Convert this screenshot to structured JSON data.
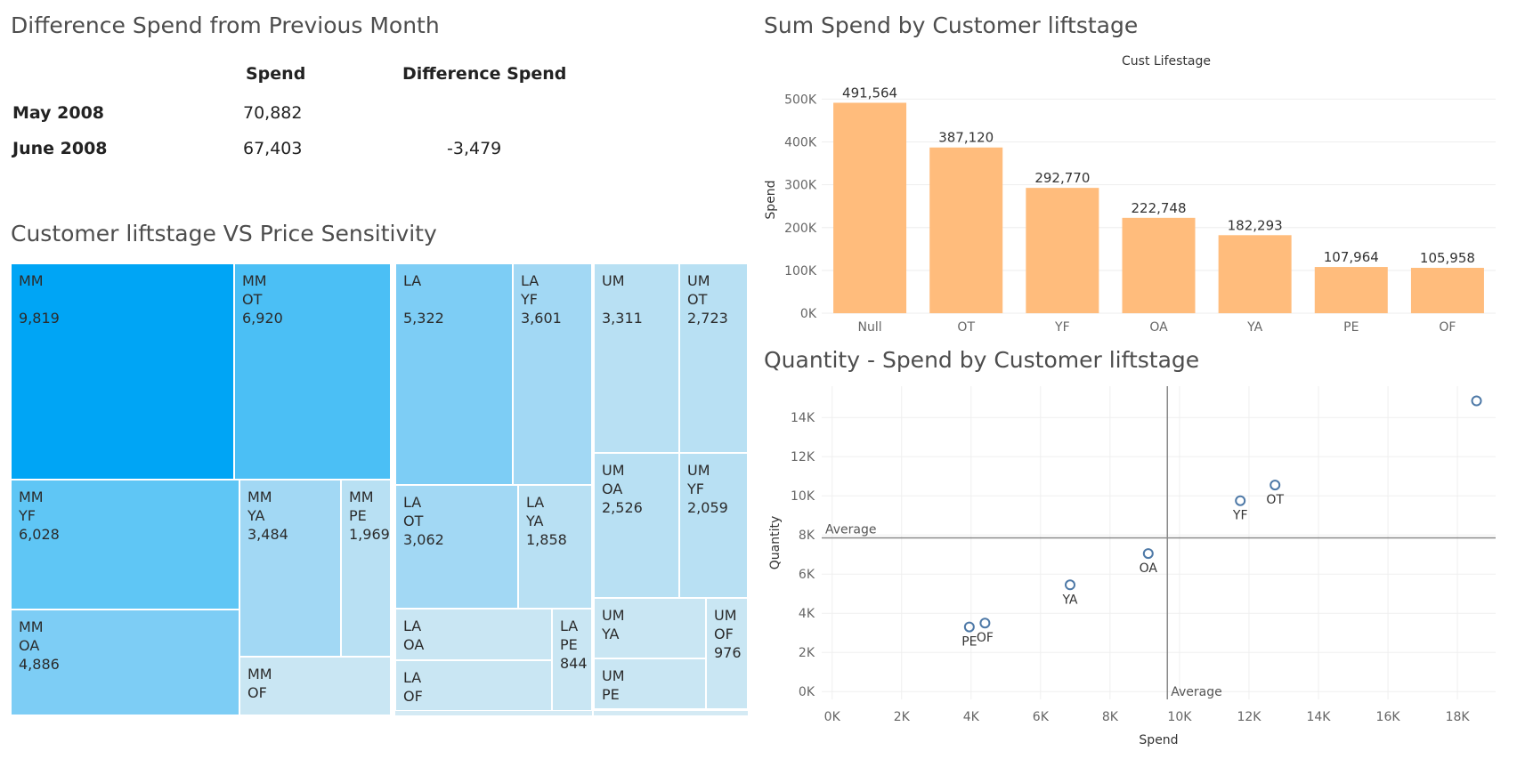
{
  "diff_table": {
    "title": "Difference Spend from Previous Month",
    "headers": [
      "Spend",
      "Difference Spend"
    ],
    "rows": [
      {
        "label": "May 2008",
        "spend": "70,882",
        "diff": ""
      },
      {
        "label": "June 2008",
        "spend": "67,403",
        "diff": "-3,479"
      }
    ]
  },
  "treemap": {
    "title": "Customer liftstage VS Price Sensitivity",
    "colors": {
      "dark": "#00a5f5",
      "mid1": "#4bbff5",
      "mid2": "#5fc6f5",
      "mid3": "#7dcdf5",
      "light1": "#a2d8f4",
      "light2": "#b8e0f3",
      "light3": "#c9e6f3",
      "light4": "#d4eaf4"
    },
    "tiles": [
      {
        "group": "MM",
        "life": "",
        "value": "9,819"
      },
      {
        "group": "MM",
        "life": "OT",
        "value": "6,920"
      },
      {
        "group": "MM",
        "life": "YF",
        "value": "6,028"
      },
      {
        "group": "MM",
        "life": "YA",
        "value": "3,484"
      },
      {
        "group": "MM",
        "life": "PE",
        "value": "1,969"
      },
      {
        "group": "MM",
        "life": "OA",
        "value": "4,886"
      },
      {
        "group": "MM",
        "life": "OF",
        "value": ""
      },
      {
        "group": "LA",
        "life": "",
        "value": "5,322"
      },
      {
        "group": "LA",
        "life": "YF",
        "value": "3,601"
      },
      {
        "group": "LA",
        "life": "OT",
        "value": "3,062"
      },
      {
        "group": "LA",
        "life": "YA",
        "value": "1,858"
      },
      {
        "group": "LA",
        "life": "OA",
        "value": ""
      },
      {
        "group": "LA",
        "life": "PE",
        "value": "844"
      },
      {
        "group": "LA",
        "life": "OF",
        "value": ""
      },
      {
        "group": "UM",
        "life": "",
        "value": "3,311"
      },
      {
        "group": "UM",
        "life": "OT",
        "value": "2,723"
      },
      {
        "group": "UM",
        "life": "OA",
        "value": "2,526"
      },
      {
        "group": "UM",
        "life": "YF",
        "value": "2,059"
      },
      {
        "group": "UM",
        "life": "YA",
        "value": ""
      },
      {
        "group": "UM",
        "life": "OF",
        "value": "976"
      },
      {
        "group": "UM",
        "life": "PE",
        "value": ""
      }
    ]
  },
  "chart_data": [
    {
      "type": "bar",
      "title": "Sum Spend by Customer liftstage",
      "subtitle": "Cust Lifestage",
      "xlabel": "",
      "ylabel": "Spend",
      "categories": [
        "Null",
        "OT",
        "YF",
        "OA",
        "YA",
        "PE",
        "OF"
      ],
      "values": [
        491564,
        387120,
        292770,
        222748,
        182293,
        107964,
        105958
      ],
      "value_labels": [
        "491,564",
        "387,120",
        "292,770",
        "222,748",
        "182,293",
        "107,964",
        "105,958"
      ],
      "ylim": [
        0,
        530000
      ],
      "yticks": [
        0,
        100000,
        200000,
        300000,
        400000,
        500000
      ],
      "ytick_labels": [
        "0K",
        "100K",
        "200K",
        "300K",
        "400K",
        "500K"
      ],
      "bar_color": "#ffbc7c",
      "grid": true
    },
    {
      "type": "scatter",
      "title": "Quantity - Spend by Customer liftstage",
      "xlabel": "Spend",
      "ylabel": "Quantity",
      "xlim": [
        -300,
        19100
      ],
      "ylim": [
        -400,
        15600
      ],
      "xticks": [
        0,
        2000,
        4000,
        6000,
        8000,
        10000,
        12000,
        14000,
        16000,
        18000
      ],
      "xtick_labels": [
        "0K",
        "2K",
        "4K",
        "6K",
        "8K",
        "10K",
        "12K",
        "14K",
        "16K",
        "18K"
      ],
      "yticks": [
        0,
        2000,
        4000,
        6000,
        8000,
        10000,
        12000,
        14000
      ],
      "ytick_labels": [
        "0K",
        "2K",
        "4K",
        "6K",
        "8K",
        "10K",
        "12K",
        "14K"
      ],
      "points": [
        {
          "label": "PE",
          "x": 3950,
          "y": 3300
        },
        {
          "label": "OF",
          "x": 4400,
          "y": 3500
        },
        {
          "label": "YA",
          "x": 6850,
          "y": 5450
        },
        {
          "label": "OA",
          "x": 9100,
          "y": 7050
        },
        {
          "label": "YF",
          "x": 11750,
          "y": 9750
        },
        {
          "label": "OT",
          "x": 12750,
          "y": 10550
        },
        {
          "label": "",
          "x": 18550,
          "y": 14850
        }
      ],
      "reference_lines": [
        {
          "axis": "y",
          "value": 7850,
          "label": "Average"
        },
        {
          "axis": "x",
          "value": 9650,
          "label": "Average"
        }
      ],
      "marker_color": "#4e79a7",
      "grid": true
    }
  ]
}
